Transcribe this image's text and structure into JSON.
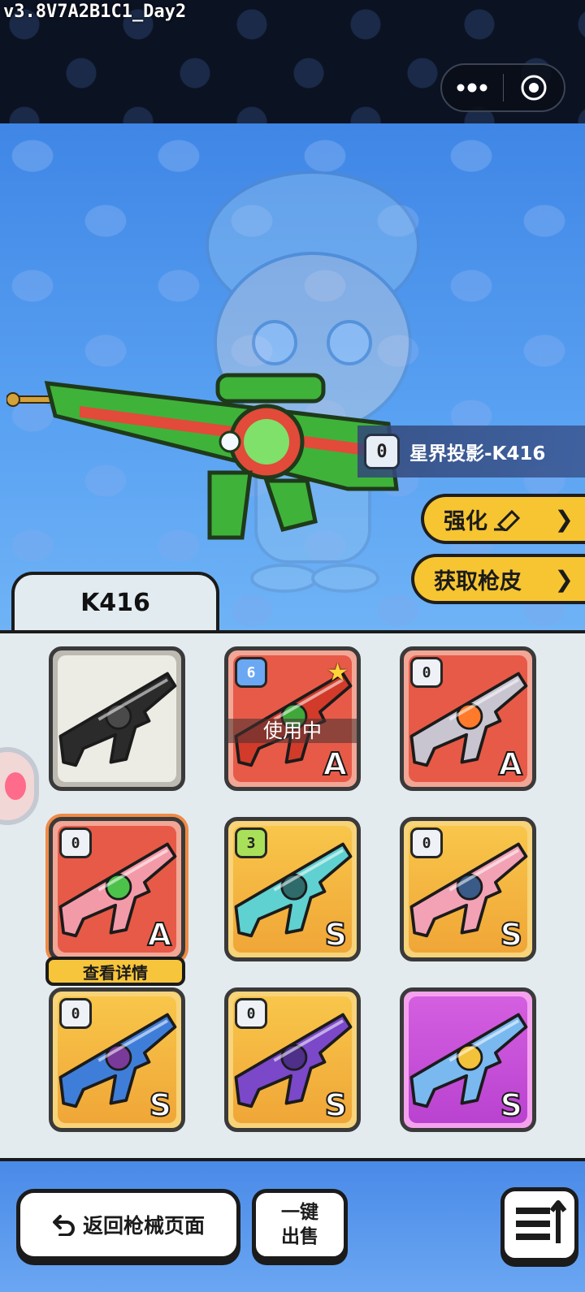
{
  "version": "v3.8V7A2B1C1_Day2",
  "capsule": {
    "more_icon": "more-dots-icon",
    "close_icon": "target-circle-icon"
  },
  "hero": {
    "level": "0",
    "skin_name": "星界投影-K416"
  },
  "actions": {
    "enhance": "强化",
    "get_skin": "获取枪皮"
  },
  "tab": {
    "label": "K416"
  },
  "cards": [
    {
      "style": "grey",
      "level": null,
      "grade": null,
      "colors": [
        "#2b2b2b",
        "#4a4a4a"
      ]
    },
    {
      "style": "red",
      "level": "6",
      "level_color": "blue",
      "grade": "A",
      "in_use": "使用中",
      "star": true,
      "colors": [
        "#d23a2a",
        "#3fa83a"
      ]
    },
    {
      "style": "red",
      "level": "0",
      "level_color": "white",
      "grade": "A",
      "colors": [
        "#c8c4d0",
        "#ff7a2a"
      ]
    },
    {
      "style": "red",
      "level": "0",
      "level_color": "white",
      "grade": "A",
      "selected": true,
      "colors": [
        "#f39aa8",
        "#4cc24a"
      ]
    },
    {
      "style": "gold",
      "level": "3",
      "level_color": "green",
      "grade": "S",
      "colors": [
        "#5fd1d0",
        "#2e6b6a"
      ]
    },
    {
      "style": "gold",
      "level": "0",
      "level_color": "white",
      "grade": "S",
      "colors": [
        "#f2a2b4",
        "#3a5a88"
      ]
    },
    {
      "style": "gold",
      "level": "0",
      "level_color": "white",
      "grade": "S",
      "colors": [
        "#3f7ed8",
        "#7a3a9a"
      ]
    },
    {
      "style": "gold",
      "level": "0",
      "level_color": "white",
      "grade": "S",
      "colors": [
        "#7a48c8",
        "#4e2f8a"
      ]
    },
    {
      "style": "purple",
      "level": null,
      "grade": "S",
      "colors": [
        "#7ab8f0",
        "#f2c23a"
      ]
    }
  ],
  "detail_button": "查看详情",
  "bottom": {
    "back_label": "返回枪械页面",
    "sell_line1": "一键",
    "sell_line2": "出售"
  }
}
